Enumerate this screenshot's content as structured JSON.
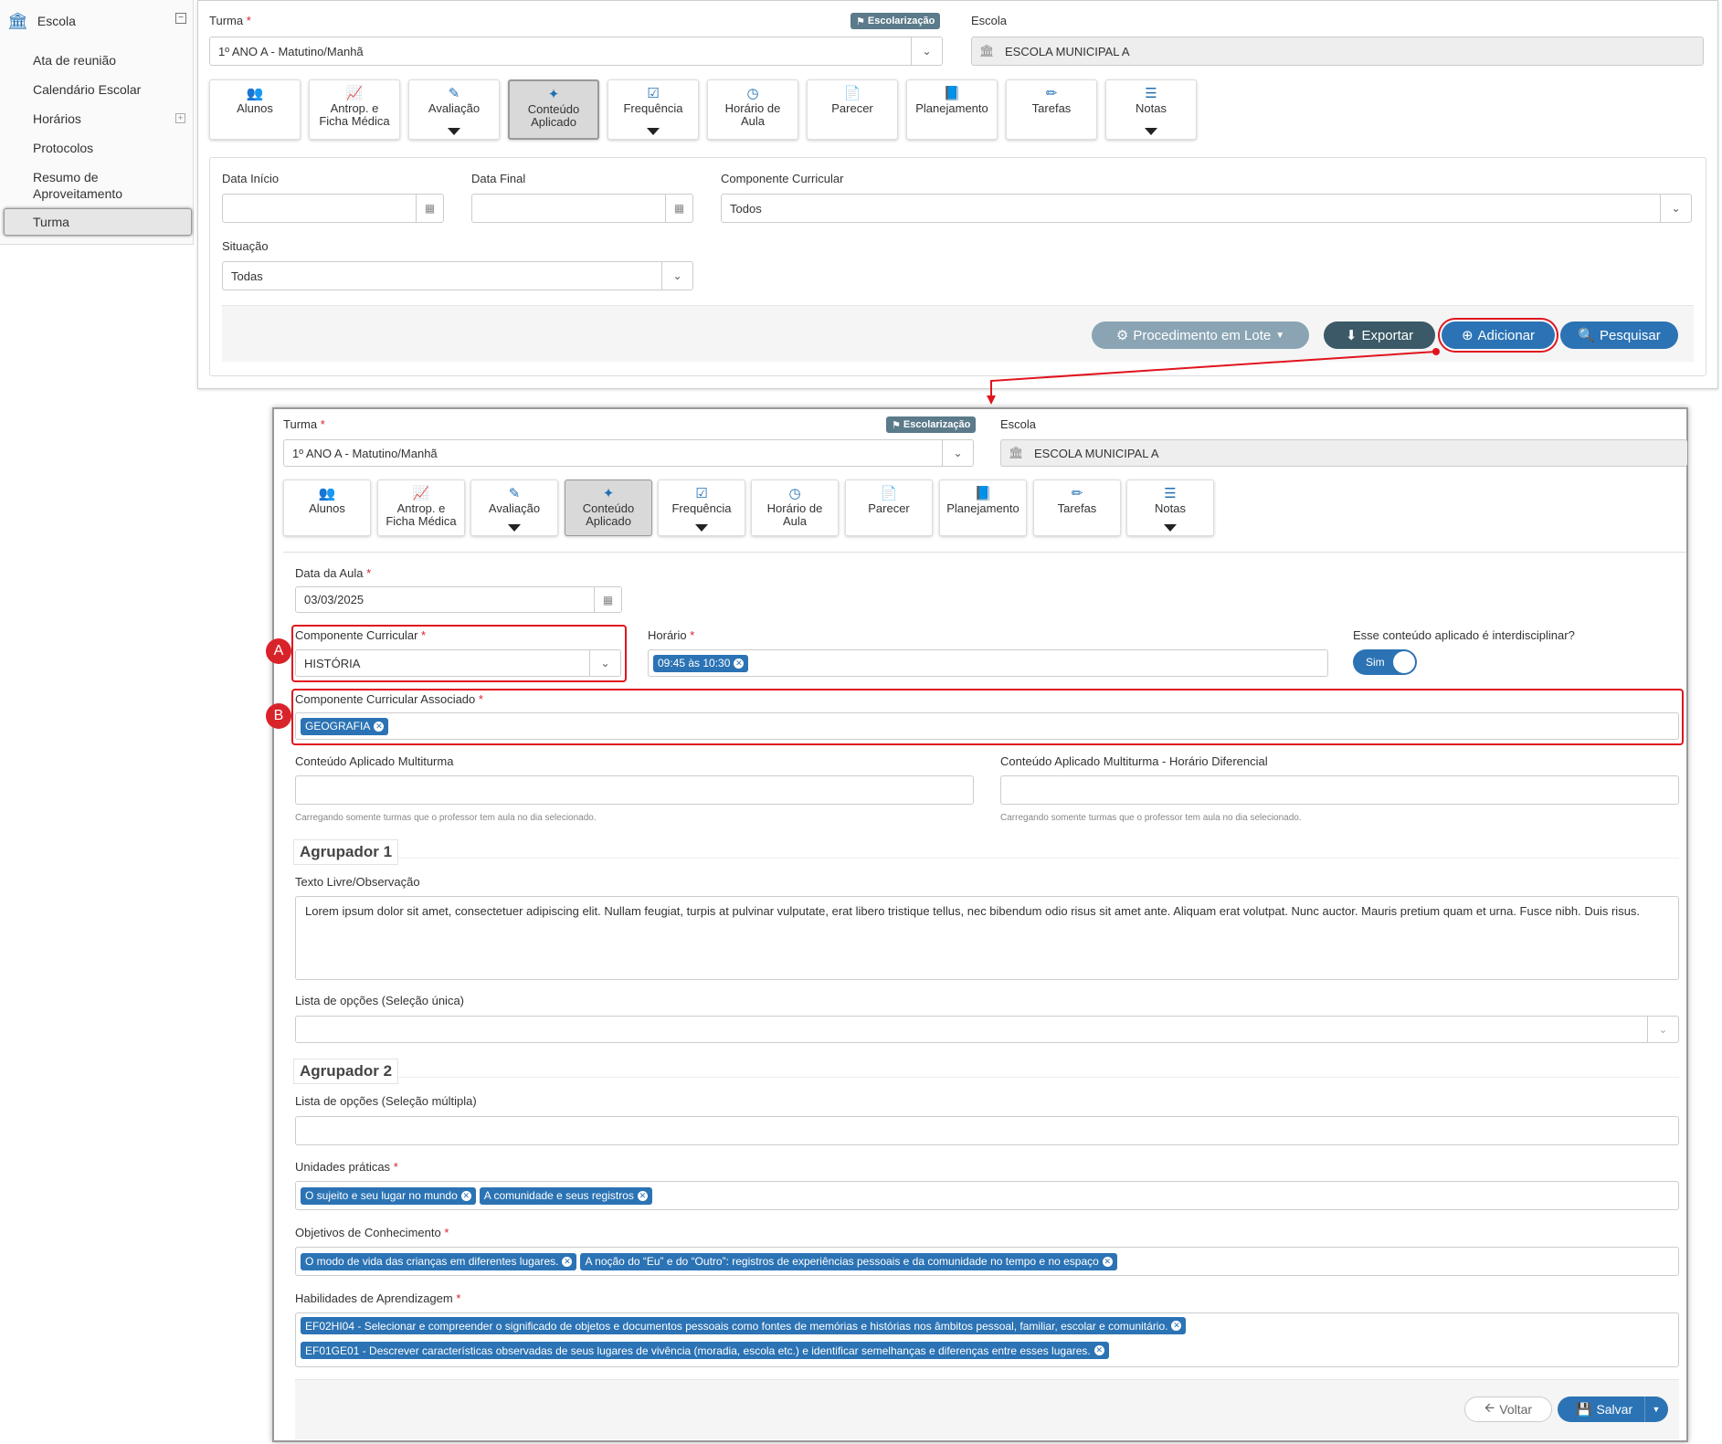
{
  "sidebar": {
    "header": "Escola",
    "items": [
      {
        "label": "Ata de reunião"
      },
      {
        "label": "Calendário Escolar"
      },
      {
        "label": "Horários"
      },
      {
        "label": "Protocolos"
      },
      {
        "label": "Resumo de Aproveitamento"
      },
      {
        "label": "Turma"
      }
    ]
  },
  "tabs": [
    {
      "label": "Alunos",
      "icon": "users-icon"
    },
    {
      "label": "Antrop. e Ficha Médica",
      "icon": "chart-line-icon"
    },
    {
      "label": "Avaliação",
      "icon": "edit-icon"
    },
    {
      "label": "Conteúdo Aplicado",
      "icon": "magic-wand-icon"
    },
    {
      "label": "Frequência",
      "icon": "check-square-icon"
    },
    {
      "label": "Horário de Aula",
      "icon": "clock-icon"
    },
    {
      "label": "Parecer",
      "icon": "document-icon"
    },
    {
      "label": "Planejamento",
      "icon": "book-icon"
    },
    {
      "label": "Tarefas",
      "icon": "pencil-icon"
    },
    {
      "label": "Notas",
      "icon": "list-icon"
    }
  ],
  "top": {
    "turma_label": "Turma",
    "turma_value": "1º ANO A - Matutino/Manhã",
    "escolarizacao": "Escolarização",
    "escola_label": "Escola",
    "escola_value": "ESCOLA MUNICIPAL A",
    "filters": {
      "data_inicio_label": "Data Início",
      "data_final_label": "Data Final",
      "componente_label": "Componente Curricular",
      "componente_value": "Todos",
      "situacao_label": "Situação",
      "situacao_value": "Todas"
    },
    "buttons": {
      "lote": "Procedimento em Lote",
      "exportar": "Exportar",
      "adicionar": "Adicionar",
      "pesquisar": "Pesquisar"
    }
  },
  "form": {
    "turma_label": "Turma",
    "turma_value": "1º ANO A - Matutino/Manhã",
    "escolarizacao": "Escolarização",
    "escola_label": "Escola",
    "escola_value": "ESCOLA MUNICIPAL A",
    "data_aula_label": "Data da Aula",
    "data_aula_value": "03/03/2025",
    "componente_label": "Componente Curricular",
    "componente_value": "HISTÓRIA",
    "horario_label": "Horário",
    "horario_chip": "09:45 às 10:30",
    "interdisciplinar_label": "Esse conteúdo aplicado é interdisciplinar?",
    "interdisciplinar_value": "Sim",
    "associado_label": "Componente Curricular Associado",
    "associado_chip": "GEOGRAFIA",
    "multiturma_label": "Conteúdo Aplicado Multiturma",
    "multiturma_hd_label": "Conteúdo Aplicado Multiturma - Horário Diferencial",
    "multiturma_hint": "Carregando somente turmas que o professor tem aula no dia selecionado.",
    "agrupador1": "Agrupador 1",
    "texto_label": "Texto Livre/Observação",
    "texto_value": "Lorem ipsum dolor sit amet, consectetuer adipiscing elit. Nullam feugiat, turpis at pulvinar vulputate, erat libero tristique tellus, nec bibendum odio risus sit amet ante. Aliquam erat volutpat. Nunc auctor. Mauris pretium quam et urna. Fusce nibh. Duis risus.",
    "lista_unica_label": "Lista de opções (Seleção única)",
    "agrupador2": "Agrupador 2",
    "lista_multipla_label": "Lista de opções (Seleção múltipla)",
    "unidades_label": "Unidades práticas",
    "unidades": [
      "O sujeito e seu lugar no mundo",
      "A comunidade e seus registros"
    ],
    "objetivos_label": "Objetivos de Conhecimento",
    "objetivos": [
      "O modo de vida das crianças em diferentes lugares.",
      "A noção do “Eu” e do “Outro”: registros de experiências pessoais e da comunidade no tempo e no espaço"
    ],
    "habilidades_label": "Habilidades de Aprendizagem",
    "habilidades": [
      "EF02HI04 - Selecionar e compreender o significado de objetos e documentos pessoais como fontes de memórias e histórias nos âmbitos pessoal, familiar, escolar e comunitário.",
      "EF01GE01 - Descrever características observadas de seus lugares de vivência (moradia, escola etc.) e identificar semelhanças e diferenças entre esses lugares."
    ],
    "voltar": "Voltar",
    "salvar": "Salvar"
  },
  "annotations": {
    "a": "A",
    "b": "B"
  },
  "colors": {
    "primary": "#2b73b4",
    "dark": "#3b5966",
    "highlight": "#e0141e"
  }
}
